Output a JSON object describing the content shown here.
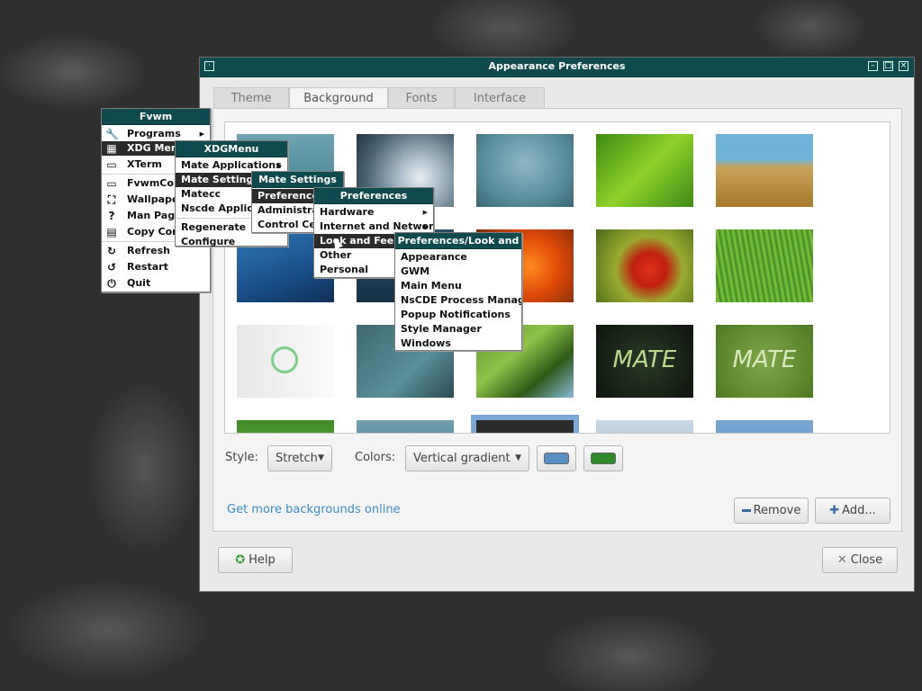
{
  "window": {
    "title": "Appearance Preferences",
    "tabs": [
      "Theme",
      "Background",
      "Fonts",
      "Interface"
    ],
    "style_label": "Style:",
    "style_value": "Stretch",
    "colors_label": "Colors:",
    "colors_value": "Vertical gradient",
    "color1": "#5a8fc4",
    "color2": "#2f8a2a",
    "more_link": "Get more backgrounds online",
    "remove_label": "Remove",
    "add_label": "Add...",
    "help_label": "Help",
    "close_label": "Close",
    "thumb_text_mate1": "MATE",
    "thumb_text_mate2": "MATE"
  },
  "fvwm_menu": {
    "title": "Fvwm",
    "items": [
      "Programs",
      "XDG Menu",
      "XTerm",
      "FvwmConsole",
      "Wallpapers",
      "Man Pages",
      "Copy Config",
      "Refresh",
      "Restart",
      "Quit"
    ]
  },
  "xdg_menu": {
    "title": "XDGMenu",
    "items": [
      "Mate Applications",
      "Mate Settings",
      "Matecc",
      "Nscde Applications",
      "Regenerate",
      "Configure"
    ]
  },
  "mate_settings_menu": {
    "title": "Mate Settings",
    "items": [
      "Preferences",
      "Administration",
      "Control Center"
    ]
  },
  "preferences_menu": {
    "title": "Preferences",
    "items": [
      "Hardware",
      "Internet and Network",
      "Look and Feel",
      "Other",
      "Personal"
    ]
  },
  "lookfeel_menu": {
    "title": "Preferences/Look and Feel",
    "items": [
      "Appearance",
      "GWM",
      "Main Menu",
      "NsCDE Process Manager",
      "Popup Notifications",
      "Style Manager",
      "Windows"
    ]
  }
}
